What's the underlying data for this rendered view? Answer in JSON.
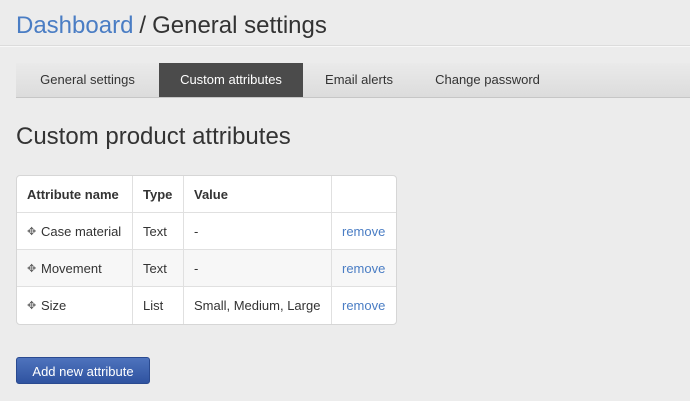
{
  "header": {
    "breadcrumb_link": "Dashboard",
    "separator": "/",
    "current": "General settings"
  },
  "tabs": [
    {
      "label": "General settings",
      "active": false
    },
    {
      "label": "Custom attributes",
      "active": true
    },
    {
      "label": "Email alerts",
      "active": false
    },
    {
      "label": "Change password",
      "active": false
    }
  ],
  "section_title": "Custom product attributes",
  "table": {
    "columns": [
      "Attribute name",
      "Type",
      "Value",
      ""
    ],
    "rows": [
      {
        "name": "Case material",
        "type": "Text",
        "value": "-",
        "action": "remove"
      },
      {
        "name": "Movement",
        "type": "Text",
        "value": "-",
        "action": "remove"
      },
      {
        "name": "Size",
        "type": "List",
        "value": "Small, Medium, Large",
        "action": "remove"
      }
    ]
  },
  "add_button_label": "Add new attribute",
  "icons": {
    "drag_handle": "move-icon"
  },
  "colors": {
    "link": "#4a7dc4",
    "active_tab": "#4b4b4b",
    "primary_button": "#3a5fb0"
  }
}
